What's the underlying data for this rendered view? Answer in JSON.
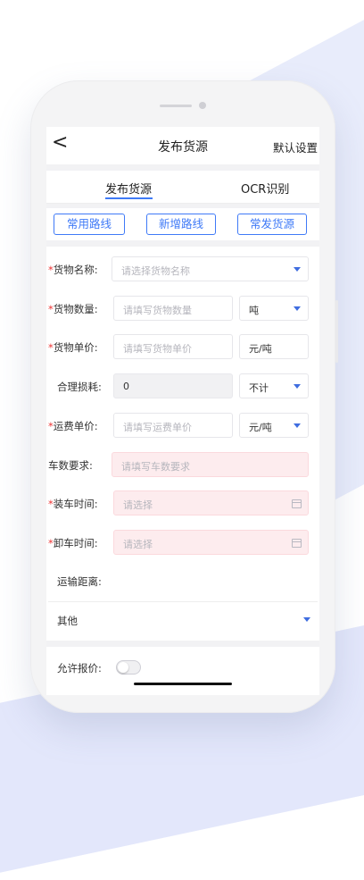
{
  "nav": {
    "title": "发布货源",
    "right_label": "默认设置",
    "back_glyph": "<"
  },
  "tabs": [
    {
      "label": "发布货源",
      "active": true
    },
    {
      "label": "OCR识别",
      "active": false
    }
  ],
  "quick_buttons": [
    "常用路线",
    "新增路线",
    "常发货源"
  ],
  "form": {
    "required_mark": "*",
    "goods_name": {
      "label": "货物名称:",
      "placeholder": "请选择货物名称"
    },
    "goods_qty": {
      "label": "货物数量:",
      "placeholder": "请填写货物数量",
      "unit": "吨"
    },
    "goods_price": {
      "label": "货物单价:",
      "placeholder": "请填写货物单价",
      "unit": "元/吨"
    },
    "loss": {
      "label": "合理损耗:",
      "value": "0",
      "unit": "不计"
    },
    "freight_price": {
      "label": "运费单价:",
      "placeholder": "请填写运费单价",
      "unit": "元/吨"
    },
    "truck_req": {
      "label": "车数要求:",
      "placeholder": "请填写车数要求"
    },
    "load_time": {
      "label": "装车时间:",
      "placeholder": "请选择"
    },
    "unload_time": {
      "label": "卸车时间:",
      "placeholder": "请选择"
    },
    "distance": {
      "label": "运输距离:"
    },
    "other": {
      "label": "其他"
    },
    "allow_quote": {
      "label": "允许报价:",
      "enabled": false
    }
  },
  "colors": {
    "accent": "#3f7af7",
    "required": "#e33333",
    "error_bg": "#fdecee"
  }
}
